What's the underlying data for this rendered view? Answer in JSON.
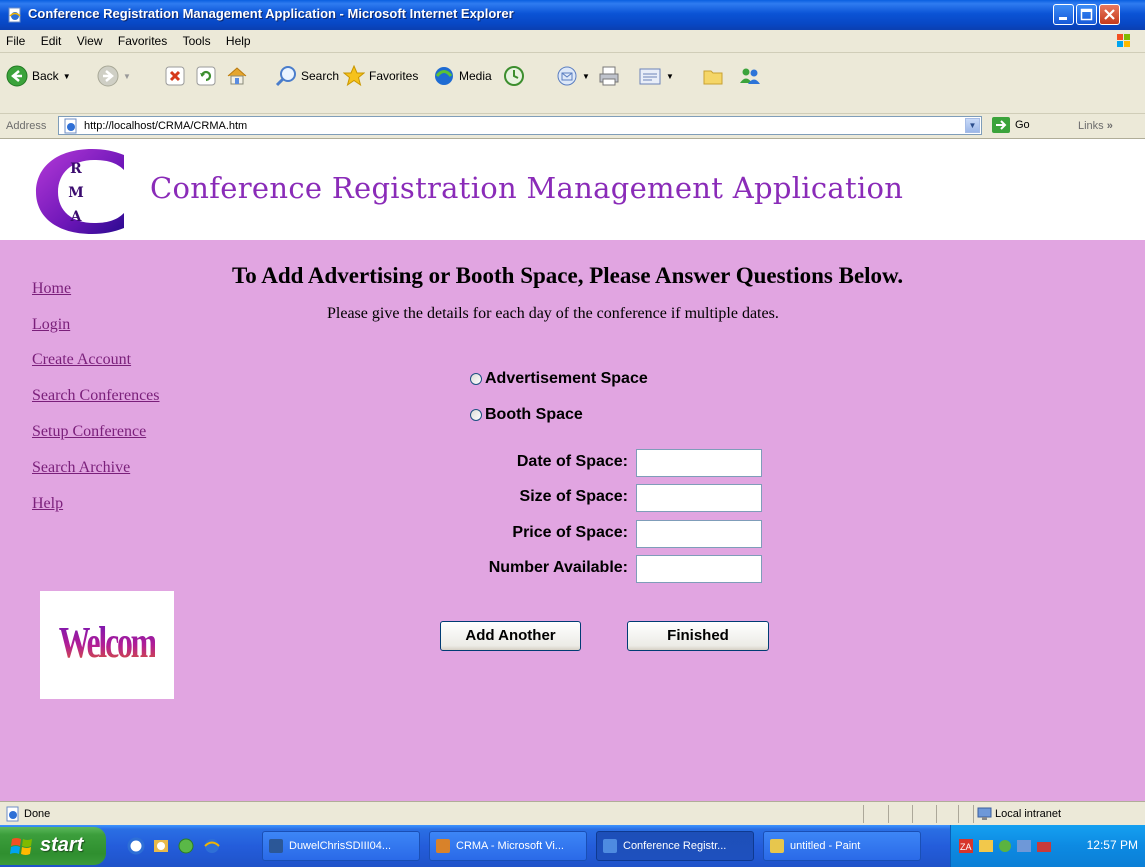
{
  "window": {
    "title": "Conference Registration Management Application - Microsoft Internet Explorer"
  },
  "menu": [
    "File",
    "Edit",
    "View",
    "Favorites",
    "Tools",
    "Help"
  ],
  "toolbar": {
    "back": "Back",
    "search": "Search",
    "favorites": "Favorites",
    "media": "Media"
  },
  "address": {
    "label": "Address",
    "url": "http://localhost/CRMA/CRMA.htm",
    "go": "Go",
    "links": "Links"
  },
  "page": {
    "logo_letters": [
      "R",
      "M",
      "A"
    ],
    "banner_title": "Conference Registration Management Application",
    "nav": [
      "Home",
      "Login",
      "Create Account",
      "Search Conferences",
      "Setup Conference",
      "Search Archive",
      "Help"
    ],
    "welcome": "Welcome",
    "heading": "To Add Advertising or Booth Space, Please Answer Questions Below.",
    "subheading": "Please give the details for each day of the conference if multiple dates.",
    "options": [
      "Advertisement Space",
      "Booth Space"
    ],
    "fields": [
      {
        "label": "Date of Space:",
        "value": ""
      },
      {
        "label": "Size of Space:",
        "value": ""
      },
      {
        "label": "Price of Space:",
        "value": ""
      },
      {
        "label": "Number Available:",
        "value": ""
      }
    ],
    "buttons": {
      "add_another": "Add Another",
      "finished": "Finished"
    }
  },
  "status": {
    "text": "Done",
    "zone": "Local intranet"
  },
  "taskbar": {
    "start": "start",
    "tasks": [
      "DuwelChrisSDIII04...",
      "CRMA - Microsoft Vi...",
      "Conference Registr...",
      "untitled - Paint"
    ],
    "clock": "12:57 PM"
  },
  "colors": {
    "page_background": "#E1A5E1",
    "banner_title": "#8A2BB8",
    "nav_link": "#7A1F7A"
  }
}
